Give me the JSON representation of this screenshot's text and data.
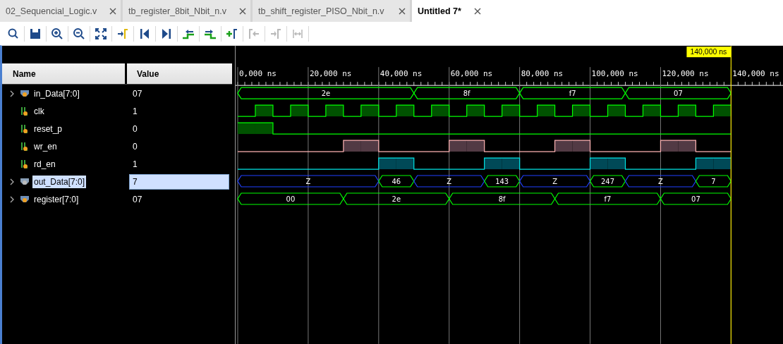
{
  "tabs": [
    {
      "label": "02_Sequencial_Logic.v",
      "selected": false
    },
    {
      "label": "tb_register_8bit_Nbit_n.v",
      "selected": false
    },
    {
      "label": "tb_shift_register_PISO_Nbit_n.v",
      "selected": false
    },
    {
      "label": "Untitled 7*",
      "selected": true
    }
  ],
  "toolbar": [
    {
      "kind": "search",
      "disabled": false
    },
    {
      "kind": "save",
      "disabled": false
    },
    {
      "kind": "zoom-in",
      "disabled": false
    },
    {
      "kind": "zoom-out",
      "disabled": false
    },
    {
      "kind": "fit",
      "disabled": false
    },
    {
      "kind": "go-to-cursor",
      "disabled": false
    },
    {
      "kind": "first",
      "disabled": false
    },
    {
      "kind": "last",
      "disabled": false
    },
    {
      "kind": "prev-edge",
      "disabled": false
    },
    {
      "kind": "next-edge",
      "disabled": false
    },
    {
      "kind": "add-marker",
      "disabled": false
    },
    {
      "kind": "prev-marker",
      "disabled": true
    },
    {
      "kind": "next-marker",
      "disabled": true
    },
    {
      "kind": "swap-markers",
      "disabled": true
    }
  ],
  "columns": {
    "name": "Name",
    "value": "Value"
  },
  "timeline": {
    "labels": [
      "0,000 ns",
      "20,000 ns",
      "40,000 ns",
      "60,000 ns",
      "80,000 ns",
      "100,000 ns",
      "120,000 ns",
      "140,000 ns"
    ],
    "cursor": "140,000 ns"
  },
  "signals": [
    {
      "name": "in_Data[7:0]",
      "value": "07",
      "kind": "bus",
      "selected": false,
      "segments": [
        {
          "label": "2e",
          "high_impedance": false
        },
        {
          "label": "8f",
          "high_impedance": false
        },
        {
          "label": "f7",
          "high_impedance": false
        },
        {
          "label": "07",
          "high_impedance": false
        }
      ]
    },
    {
      "name": "clk",
      "value": "1",
      "kind": "bit",
      "selected": false
    },
    {
      "name": "reset_p",
      "value": "0",
      "kind": "bit",
      "selected": false
    },
    {
      "name": "wr_en",
      "value": "0",
      "kind": "bit",
      "selected": false
    },
    {
      "name": "rd_en",
      "value": "1",
      "kind": "bit",
      "selected": false
    },
    {
      "name": "out_Data[7:0]",
      "value": "7",
      "kind": "bus",
      "selected": true,
      "segments": [
        {
          "label": "Z",
          "high_impedance": true
        },
        {
          "label": "46",
          "high_impedance": false
        },
        {
          "label": "Z",
          "high_impedance": true
        },
        {
          "label": "143",
          "high_impedance": false
        },
        {
          "label": "Z",
          "high_impedance": true
        },
        {
          "label": "247",
          "high_impedance": false
        },
        {
          "label": "Z",
          "high_impedance": true
        },
        {
          "label": "7",
          "high_impedance": false
        }
      ]
    },
    {
      "name": "register[7:0]",
      "value": "07",
      "kind": "bus",
      "selected": false,
      "segments": [
        {
          "label": "00",
          "high_impedance": false
        },
        {
          "label": "2e",
          "high_impedance": false
        },
        {
          "label": "8f",
          "high_impedance": false
        },
        {
          "label": "f7",
          "high_impedance": false
        },
        {
          "label": "07",
          "high_impedance": false
        }
      ]
    }
  ]
}
